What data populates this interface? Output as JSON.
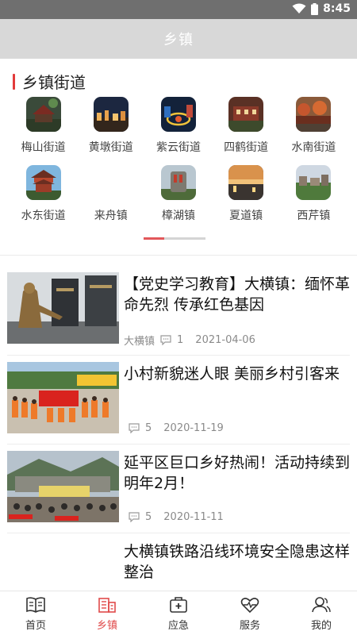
{
  "status_bar": {
    "time": "8:45",
    "icons": [
      "wifi-icon",
      "battery-icon"
    ]
  },
  "header": {
    "title": "乡镇"
  },
  "section": {
    "title": "乡镇街道",
    "accent_color": "#e23b3b"
  },
  "towns": [
    {
      "label": "梅山街道"
    },
    {
      "label": "黄墩街道"
    },
    {
      "label": "紫云街道"
    },
    {
      "label": "四鹤街道"
    },
    {
      "label": "水南街道"
    },
    {
      "label": "水东街道"
    },
    {
      "label": "来舟镇"
    },
    {
      "label": "樟湖镇"
    },
    {
      "label": "夏道镇"
    },
    {
      "label": "西芹镇"
    }
  ],
  "carousel": {
    "pages": 3,
    "active_page": 1
  },
  "news": [
    {
      "title": "【党史学习教育】大横镇：缅怀革命先烈 传承红色基因",
      "source": "大横镇",
      "comments": "1",
      "date": "2021-04-06"
    },
    {
      "title": "小村新貌迷人眼 美丽乡村引客来",
      "source": "",
      "comments": "5",
      "date": "2020-11-19"
    },
    {
      "title": "延平区巨口乡好热闹！活动持续到明年2月！",
      "source": "",
      "comments": "5",
      "date": "2020-11-11"
    },
    {
      "title": "大横镇铁路沿线环境安全隐患这样整治",
      "source": "",
      "comments": "",
      "date": ""
    }
  ],
  "tabbar": {
    "tabs": [
      {
        "label": "首页",
        "icon": "book-icon"
      },
      {
        "label": "乡镇",
        "icon": "building-icon",
        "active": true
      },
      {
        "label": "应急",
        "icon": "first-aid-icon"
      },
      {
        "label": "服务",
        "icon": "heart-pulse-icon"
      },
      {
        "label": "我的",
        "icon": "user-icon"
      }
    ],
    "active_color": "#e04a4a"
  }
}
